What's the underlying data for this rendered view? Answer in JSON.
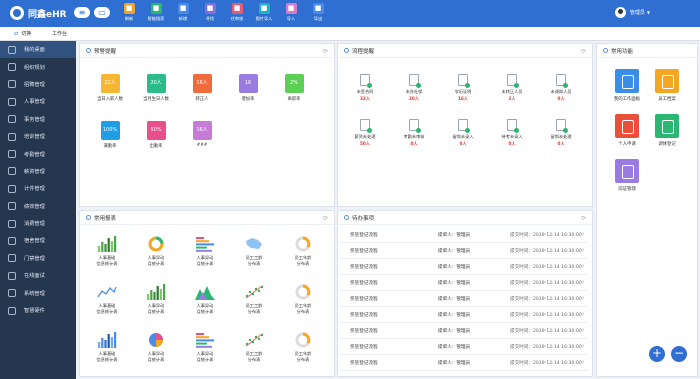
{
  "app": {
    "name": "同鑫eHR"
  },
  "toolbar": [
    {
      "label": "刷新",
      "color": "#f0a32b"
    },
    {
      "label": "智能搜索",
      "color": "#2bb673"
    },
    {
      "label": "新增",
      "color": "#4a8bea"
    },
    {
      "label": "寻找",
      "color": "#8e6ad8"
    },
    {
      "label": "任审核",
      "color": "#e25d7a"
    },
    {
      "label": "图片导入",
      "color": "#23b1c1"
    },
    {
      "label": "导入",
      "color": "#d67bc8"
    },
    {
      "label": "导出",
      "color": "#4a8bea"
    }
  ],
  "user": {
    "name": "管理员"
  },
  "subnav": {
    "switch": "切换",
    "workbench": "工作台"
  },
  "sidebar": [
    "我的桌面",
    "组织规划",
    "招聘管理",
    "人事管理",
    "事务管理",
    "培训管理",
    "考勤管理",
    "薪资管理",
    "计件管理",
    "绩效管理",
    "消费管理",
    "宿舍管理",
    "门禁管理",
    "在线面试",
    "系统管理",
    "智慧硬件"
  ],
  "alerts": {
    "title": "预警提醒",
    "items": [
      {
        "value": "22人",
        "label": "当日入职人数",
        "color": "#f5b731"
      },
      {
        "value": "20人",
        "label": "当月生日人数",
        "color": "#2bbc8a"
      },
      {
        "value": "16人",
        "label": "转正人",
        "color": "#f06a3c"
      },
      {
        "value": "16",
        "label": "增加率",
        "color": "#9a7be0"
      },
      {
        "value": "2%",
        "label": "离职率",
        "color": "#5ccf55"
      },
      {
        "value": "100%",
        "label": "满勤率",
        "color": "#1e9ee6"
      },
      {
        "value": "50%",
        "label": "出勤率",
        "color": "#e8508b"
      },
      {
        "value": "16人",
        "label": "###",
        "color": "#c77ad8"
      }
    ]
  },
  "flows": {
    "title": "流程提醒",
    "items": [
      {
        "label": "未签合同",
        "count": "32人"
      },
      {
        "label": "未办社保",
        "count": "20人"
      },
      {
        "label": "学历证明",
        "count": "16人"
      },
      {
        "label": "未转正人员",
        "count": "2人"
      },
      {
        "label": "未调岗人员",
        "count": "0人"
      },
      {
        "label": "薪资未处理",
        "count": "50人"
      },
      {
        "label": "考勤未审核",
        "count": "0人"
      },
      {
        "label": "留岗未录入",
        "count": "0人"
      },
      {
        "label": "待考未录入",
        "count": "0人"
      },
      {
        "label": "留岗未处理",
        "count": "0人"
      }
    ]
  },
  "functions": {
    "title": "常用功能",
    "items": [
      {
        "label": "我的工作面板",
        "color": "#3a8ee6"
      },
      {
        "label": "员工档案",
        "color": "#f5a623"
      },
      {
        "label": "个人申请",
        "color": "#e8503a"
      },
      {
        "label": "调休登记",
        "color": "#2bb673"
      },
      {
        "label": "岗证管理",
        "color": "#9a7be0"
      }
    ]
  },
  "reports": {
    "title": "常用报表",
    "items": [
      {
        "label1": "人事基础",
        "label2": "信息统计表",
        "type": "bars-green"
      },
      {
        "label1": "人事异动",
        "label2": "月统计表",
        "type": "donut"
      },
      {
        "label1": "人事异动",
        "label2": "月统计表",
        "type": "hbars"
      },
      {
        "label1": "员工工龄",
        "label2": "分布表",
        "type": "map"
      },
      {
        "label1": "员工年龄",
        "label2": "分布表",
        "type": "ring"
      },
      {
        "label1": "人事基础",
        "label2": "信息统计表",
        "type": "line"
      },
      {
        "label1": "人事异动",
        "label2": "月统计表",
        "type": "bars-green"
      },
      {
        "label1": "人事异动",
        "label2": "月统计表",
        "type": "mountain"
      },
      {
        "label1": "员工工龄",
        "label2": "分布表",
        "type": "scatter"
      },
      {
        "label1": "员工年龄",
        "label2": "分布表",
        "type": "ring"
      },
      {
        "label1": "人事基础",
        "label2": "信息统计表",
        "type": "bars-blue"
      },
      {
        "label1": "人事异动",
        "label2": "月统计表",
        "type": "pie"
      },
      {
        "label1": "人事异动",
        "label2": "月统计表",
        "type": "hbars"
      },
      {
        "label1": "员工工龄",
        "label2": "分布表",
        "type": "scatter"
      },
      {
        "label1": "员工年龄",
        "label2": "分布表",
        "type": "ring"
      }
    ]
  },
  "todos": {
    "title": "待办事项",
    "items": [
      {
        "name": "奖惩登记流程",
        "applicant": "提单人：管理员",
        "time": "提交时间：2019-12-14 16:30:00"
      },
      {
        "name": "奖惩登记流程",
        "applicant": "提单人：管理员",
        "time": "提交时间：2019-12-14 16:30:00"
      },
      {
        "name": "奖惩登记流程",
        "applicant": "提单人：管理员",
        "time": "提交时间：2019-12-14 16:30:00"
      },
      {
        "name": "奖惩登记流程",
        "applicant": "提单人：管理员",
        "time": "提交时间：2019-12-14 16:30:00"
      },
      {
        "name": "奖惩登记流程",
        "applicant": "提单人：管理员",
        "time": "提交时间：2019-12-14 16:30:00"
      },
      {
        "name": "奖惩登记流程",
        "applicant": "提单人：管理员",
        "time": "提交时间：2019-12-14 16:30:00"
      },
      {
        "name": "奖惩登记流程",
        "applicant": "提单人：管理员",
        "time": "提交时间：2019-12-14 16:30:00"
      },
      {
        "name": "奖惩登记流程",
        "applicant": "提单人：管理员",
        "time": "提交时间：2019-12-14 16:30:00"
      },
      {
        "name": "奖惩登记流程",
        "applicant": "提单人：管理员",
        "time": "提交时间：2019-12-14 16:30:00"
      },
      {
        "name": "奖惩登记流程",
        "applicant": "提单人：管理员",
        "time": "提交时间：2019-12-14 16:30:00"
      }
    ]
  },
  "fab": {
    "add": "+",
    "remove": "−"
  }
}
